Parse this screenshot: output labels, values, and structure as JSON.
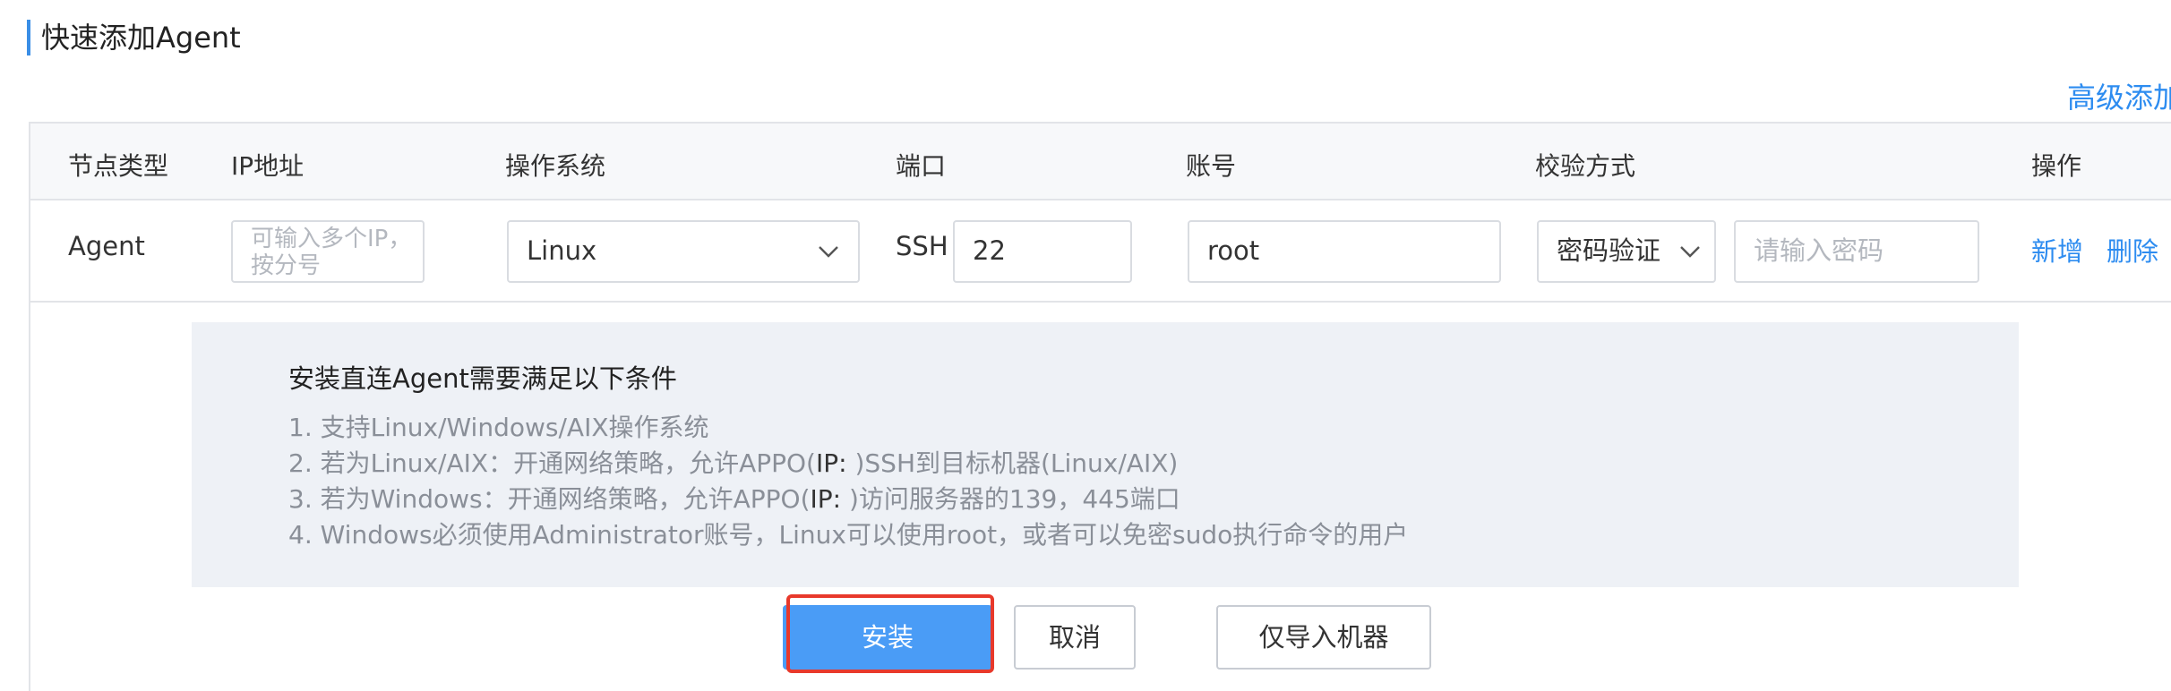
{
  "page": {
    "title": "快速添加Agent",
    "advanced_link": "高级添加"
  },
  "table": {
    "headers": [
      "节点类型",
      "IP地址",
      "操作系统",
      "端口",
      "账号",
      "校验方式",
      "操作"
    ],
    "row": {
      "node_type": "Agent",
      "ip_placeholder": "可输入多个IP，按分号",
      "os_value": "Linux",
      "port_label": "SSH",
      "port_value": "22",
      "account_value": "root",
      "auth_method": "密码验证",
      "password_placeholder": "请输入密码",
      "action_add": "新增",
      "action_delete": "删除"
    }
  },
  "notice": {
    "title": "安装直连Agent需要满足以下条件",
    "line1": "1. 支持Linux/Windows/AIX操作系统",
    "line2_pre": "2. 若为Linux/AIX：开通网络策略，允许APPO(",
    "line2_ip": "IP: ",
    "line2_post": ")SSH到目标机器(Linux/AIX)",
    "line3_pre": "3. 若为Windows：开通网络策略，允许APPO(",
    "line3_ip": "IP: ",
    "line3_post": ")访问服务器的139，445端口",
    "line4": "4. Windows必须使用Administrator账号，Linux可以使用root，或者可以免密sudo执行命令的用户"
  },
  "buttons": {
    "install": "安装",
    "cancel": "取消",
    "import_only": "仅导入机器"
  },
  "colors": {
    "accent": "#2d8cf0",
    "primary_button": "#4a9cf6",
    "highlight": "#e8392b"
  },
  "icons": {
    "dropdown": "chevron-down-icon"
  }
}
